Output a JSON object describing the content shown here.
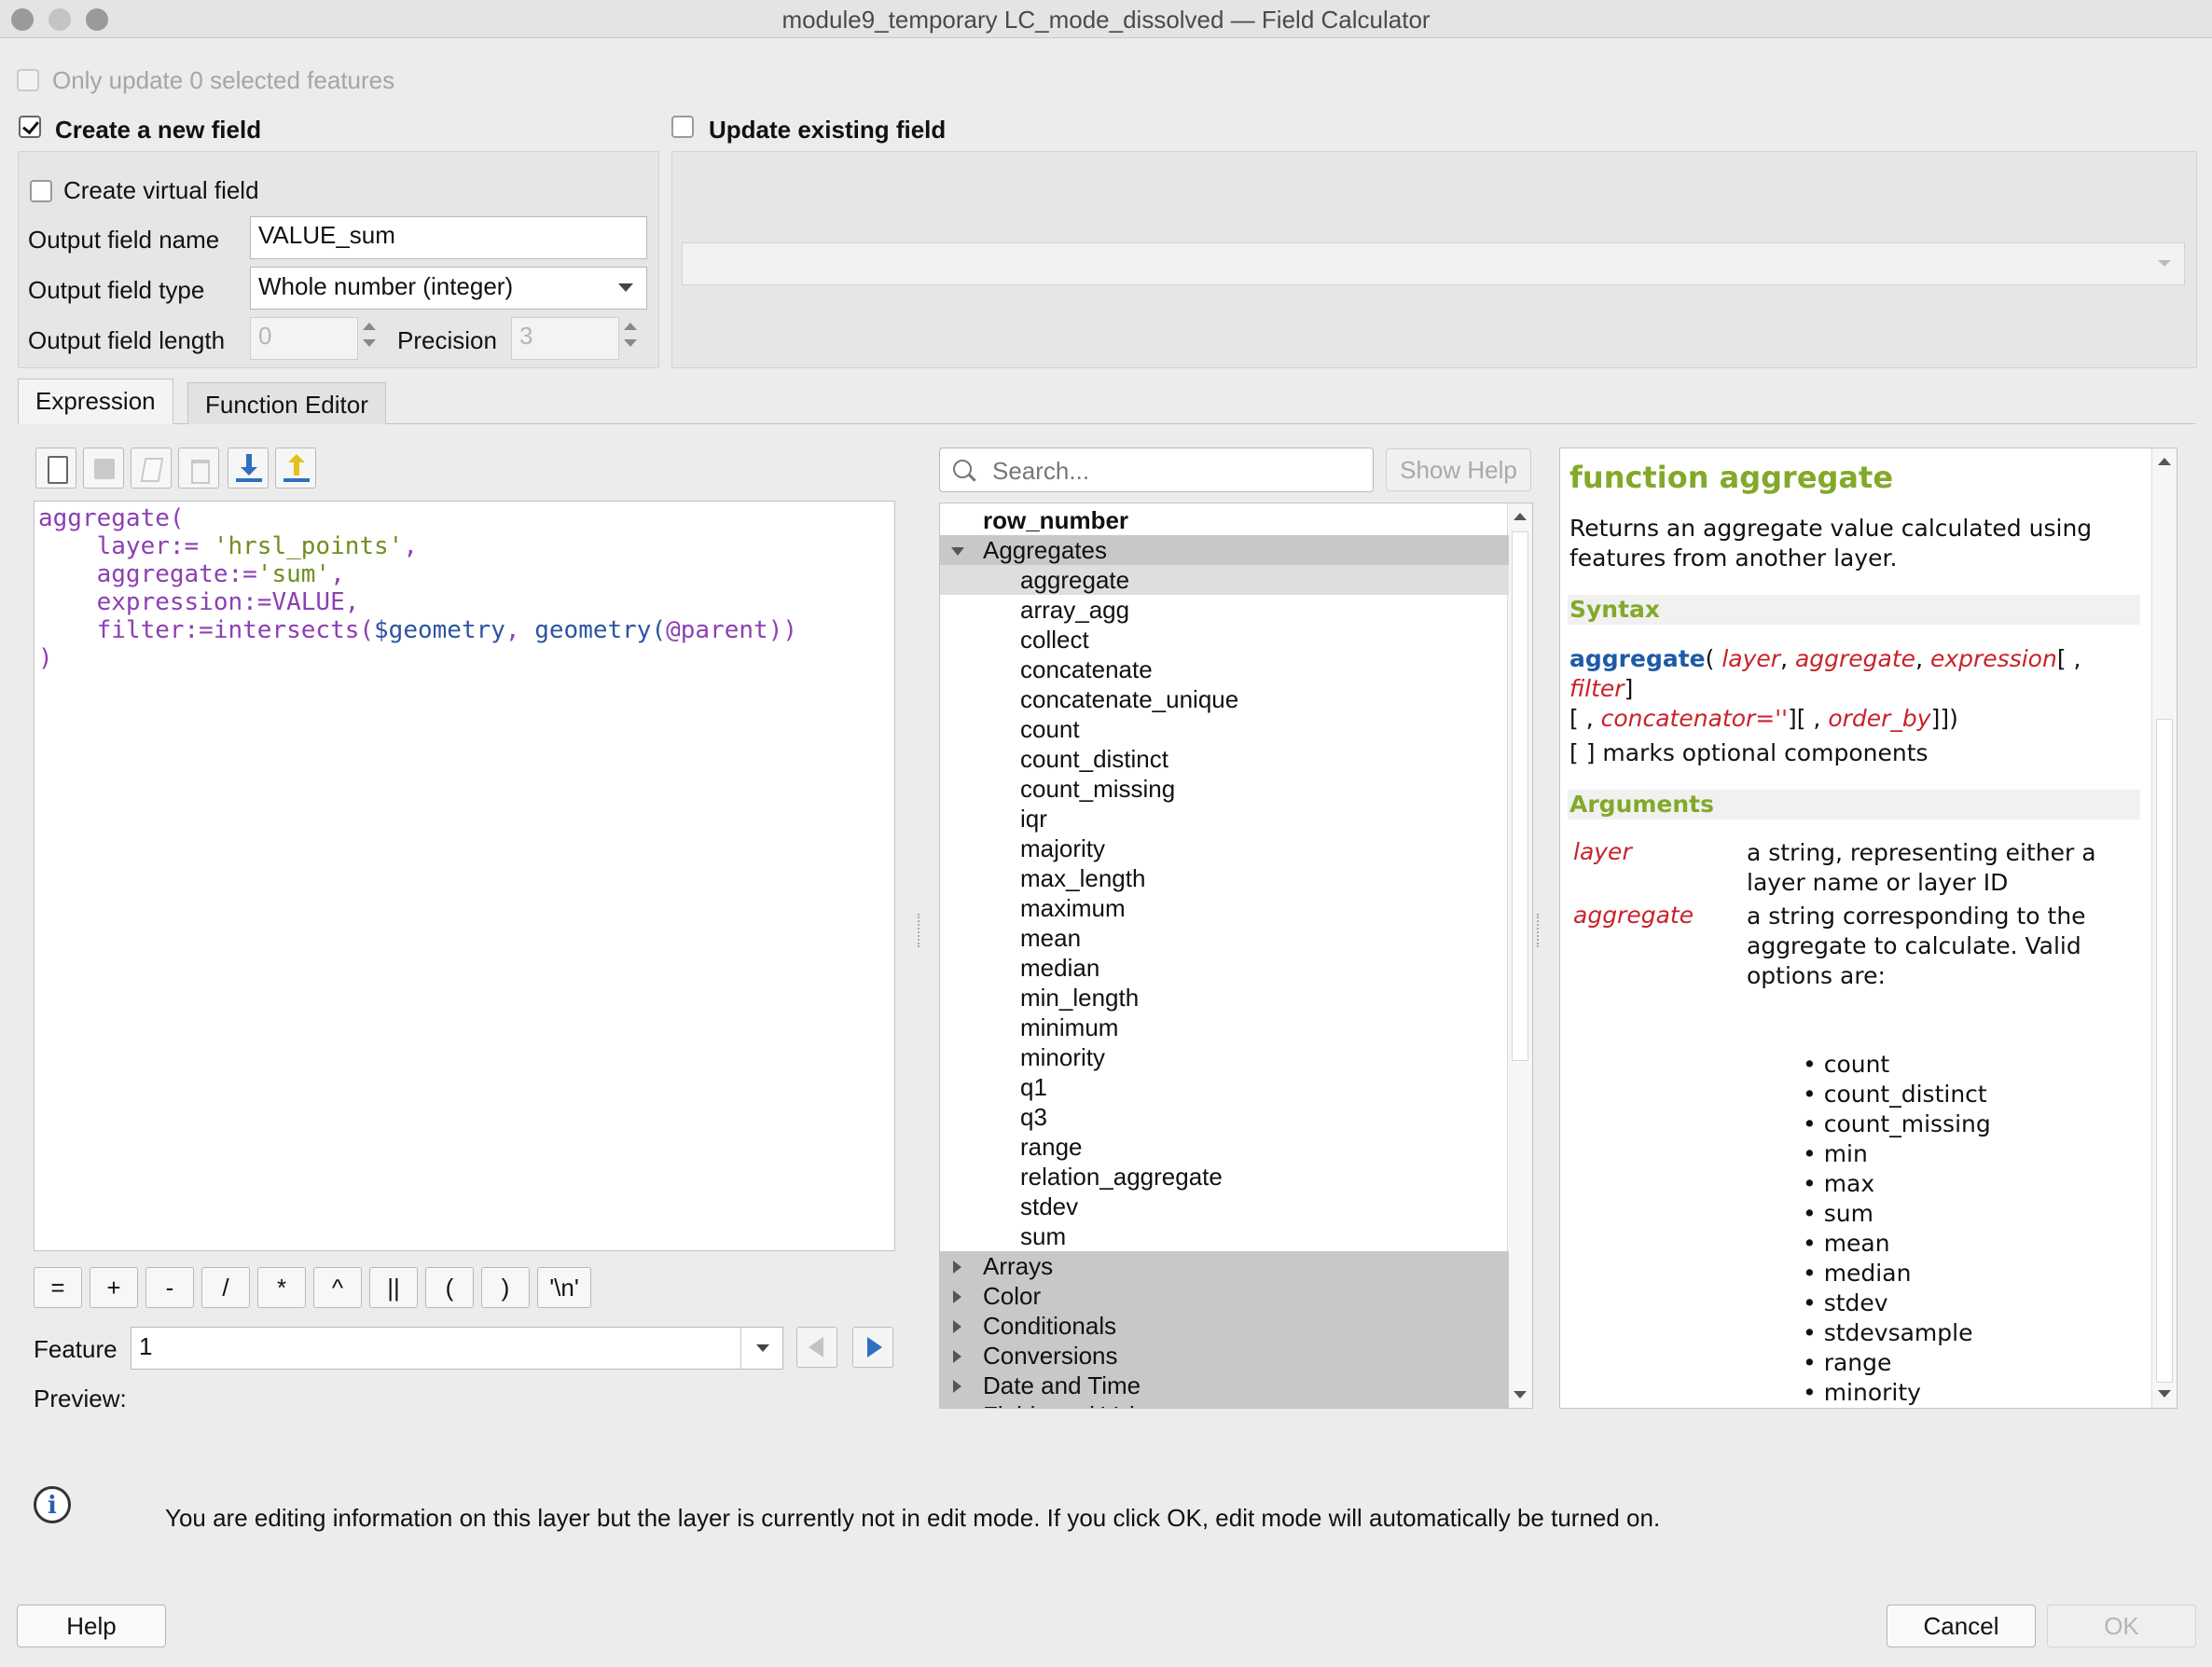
{
  "window": {
    "title": "module9_temporary LC_mode_dissolved — Field Calculator"
  },
  "top": {
    "only_update_label": "Only update 0 selected features",
    "create_new_field_label": "Create a new field",
    "update_existing_label": "Update existing field",
    "create_virtual_label": "Create virtual field",
    "output_name_label": "Output field name",
    "output_name_value": "VALUE_sum",
    "output_type_label": "Output field type",
    "output_type_value": "Whole number (integer)",
    "output_length_label": "Output field length",
    "output_length_value": "0",
    "precision_label": "Precision",
    "precision_value": "3"
  },
  "tabs": [
    {
      "label": "Expression"
    },
    {
      "label": "Function Editor"
    }
  ],
  "expression": {
    "lines": [
      [
        {
          "t": "aggregate(",
          "c": "fn"
        }
      ],
      [
        {
          "t": "    layer:= ",
          "c": "fn"
        },
        {
          "t": "'hrsl_points'",
          "c": "str"
        },
        {
          "t": ",",
          "c": "fn"
        }
      ],
      [
        {
          "t": "    aggregate:=",
          "c": "fn"
        },
        {
          "t": "'sum'",
          "c": "str"
        },
        {
          "t": ",",
          "c": "fn"
        }
      ],
      [
        {
          "t": "    expression:=VALUE,",
          "c": "fn"
        }
      ],
      [
        {
          "t": "    filter:=intersects(",
          "c": "fn"
        },
        {
          "t": "$geometry",
          "c": "geo"
        },
        {
          "t": ", ",
          "c": "fn"
        },
        {
          "t": "geometry(",
          "c": "geo"
        },
        {
          "t": "@parent",
          "c": "fn"
        },
        {
          "t": "))",
          "c": "fn"
        }
      ],
      [
        {
          "t": ")",
          "c": "fn"
        }
      ]
    ],
    "operators": [
      "=",
      "+",
      "-",
      "/",
      "*",
      "^",
      "||",
      "(",
      ")",
      "'\\n'"
    ],
    "feature_label": "Feature",
    "feature_value": "1",
    "preview_label": "Preview:"
  },
  "function_list": {
    "search_placeholder": "Search...",
    "show_help_label": "Show Help",
    "top_item": "row_number",
    "group_open": "Aggregates",
    "items": [
      "aggregate",
      "array_agg",
      "collect",
      "concatenate",
      "concatenate_unique",
      "count",
      "count_distinct",
      "count_missing",
      "iqr",
      "majority",
      "max_length",
      "maximum",
      "mean",
      "median",
      "min_length",
      "minimum",
      "minority",
      "q1",
      "q3",
      "range",
      "relation_aggregate",
      "stdev",
      "sum"
    ],
    "selected_item": "aggregate",
    "groups_closed": [
      "Arrays",
      "Color",
      "Conditionals",
      "Conversions",
      "Date and Time",
      "Fields and Values"
    ]
  },
  "help": {
    "title": "function aggregate",
    "desc": "Returns an aggregate value calculated using features from another layer.",
    "syntax_heading": "Syntax",
    "syntax_fn": "aggregate",
    "syntax_args": [
      "layer",
      "aggregate",
      "expression",
      "filter",
      "concatenator=''",
      "order_by"
    ],
    "optional_note": "[ ] marks optional components",
    "arguments_heading": "Arguments",
    "arguments": [
      {
        "name": "layer",
        "desc": "a string, representing either a layer name or layer ID"
      },
      {
        "name": "aggregate",
        "desc": "a string corresponding to the aggregate to calculate. Valid options are:"
      }
    ],
    "options": [
      "count",
      "count_distinct",
      "count_missing",
      "min",
      "max",
      "sum",
      "mean",
      "median",
      "stdev",
      "stdevsample",
      "range",
      "minority"
    ]
  },
  "info": {
    "message": "You are editing information on this layer but the layer is currently not in edit mode. If you click OK, edit mode will automatically be turned on."
  },
  "buttons": {
    "help": "Help",
    "cancel": "Cancel",
    "ok": "OK"
  }
}
